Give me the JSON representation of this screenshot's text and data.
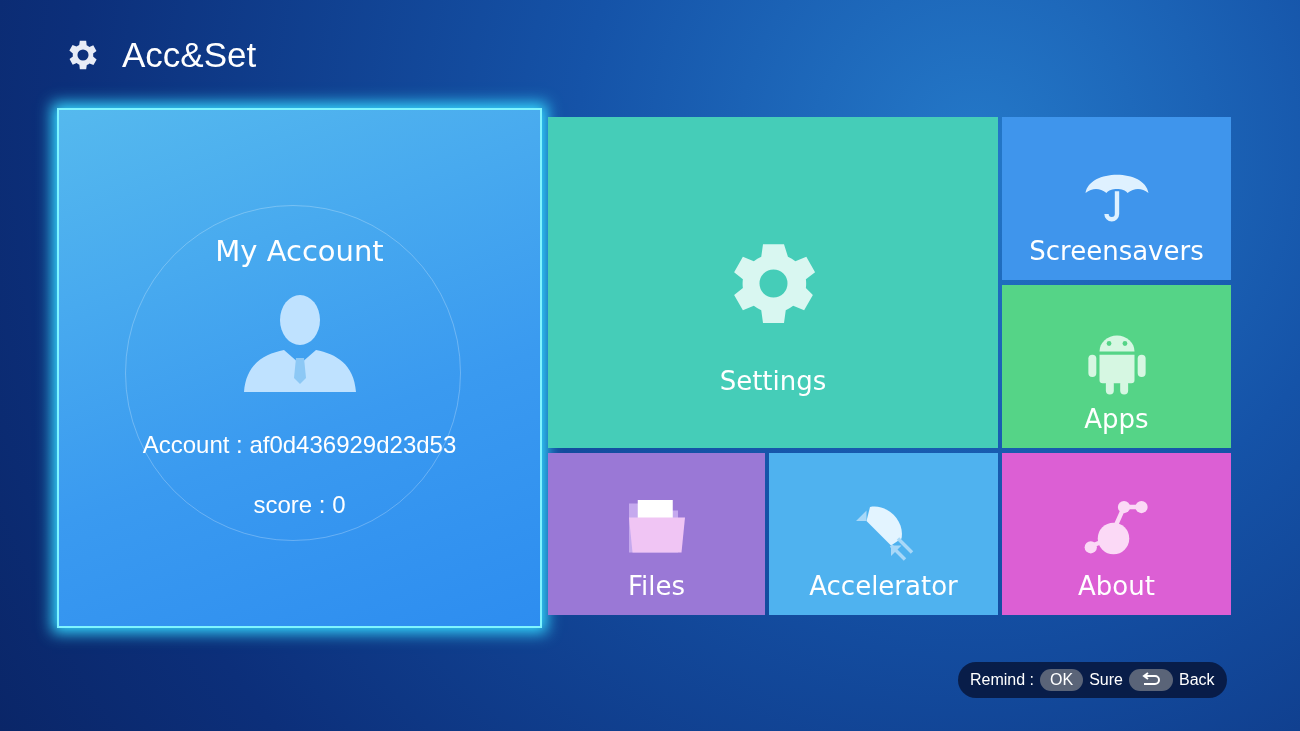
{
  "header": {
    "title": "Acc&Set"
  },
  "account": {
    "title": "My Account",
    "account_line": "Account : af0d436929d23d53",
    "score_line": "score : 0",
    "selected": true
  },
  "tiles": [
    {
      "kind": "settings",
      "label": "Settings",
      "color": "#45cdb8",
      "selected": false
    },
    {
      "kind": "screensavers",
      "label": "Screensavers",
      "color": "#3f95ec",
      "selected": false
    },
    {
      "kind": "apps",
      "label": "Apps",
      "color": "#55d487",
      "selected": false
    },
    {
      "kind": "files",
      "label": "Files",
      "color": "#9a78d6",
      "selected": false
    },
    {
      "kind": "accelerator",
      "label": "Accelerator",
      "color": "#4fb2ef",
      "selected": false
    },
    {
      "kind": "about",
      "label": "About",
      "color": "#dc5fd4",
      "selected": false
    }
  ],
  "hint": {
    "label": "Remind :",
    "ok_key": "OK",
    "ok_action": "Sure",
    "back_action": "Back"
  }
}
